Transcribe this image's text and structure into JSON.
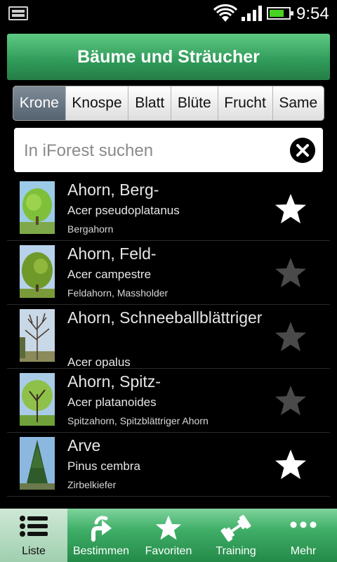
{
  "status_bar": {
    "time": "9:54",
    "battery_level": 0.75,
    "icons": [
      "image-notification-icon",
      "wifi-icon",
      "signal-icon",
      "battery-icon"
    ]
  },
  "header": {
    "title": "Bäume und Sträucher"
  },
  "tabs": [
    {
      "label": "Krone",
      "active": true
    },
    {
      "label": "Knospe",
      "active": false
    },
    {
      "label": "Blatt",
      "active": false
    },
    {
      "label": "Blüte",
      "active": false
    },
    {
      "label": "Frucht",
      "active": false
    },
    {
      "label": "Same",
      "active": false
    }
  ],
  "search": {
    "placeholder": "In iForest suchen",
    "value": ""
  },
  "items": [
    {
      "title": "Ahorn, Berg-",
      "latin": "Acer pseudoplatanus",
      "common": "Bergahorn",
      "favorite": true
    },
    {
      "title": "Ahorn, Feld-",
      "latin": "Acer campestre",
      "common": "Feldahorn, Massholder",
      "favorite": false
    },
    {
      "title": "Ahorn, Schneeballblättriger",
      "latin": "Acer opalus",
      "common": "",
      "favorite": false
    },
    {
      "title": "Ahorn, Spitz-",
      "latin": "Acer platanoides",
      "common": "Spitzahorn, Spitzblättriger Ahorn",
      "favorite": false
    },
    {
      "title": "Arve",
      "latin": "Pinus cembra",
      "common": "Zirbelkiefer",
      "favorite": true
    }
  ],
  "bottom_nav": [
    {
      "label": "Liste",
      "icon": "list-icon",
      "active": true
    },
    {
      "label": "Bestimmen",
      "icon": "determine-icon",
      "active": false
    },
    {
      "label": "Favoriten",
      "icon": "star-icon",
      "active": false
    },
    {
      "label": "Training",
      "icon": "dumbbell-icon",
      "active": false
    },
    {
      "label": "Mehr",
      "icon": "more-icon",
      "active": false
    }
  ],
  "colors": {
    "header_green": "#2f9a59",
    "star_favorite": "#ffffff",
    "star_inactive": "#4a4a4a",
    "tab_active": "#5f6b77"
  }
}
